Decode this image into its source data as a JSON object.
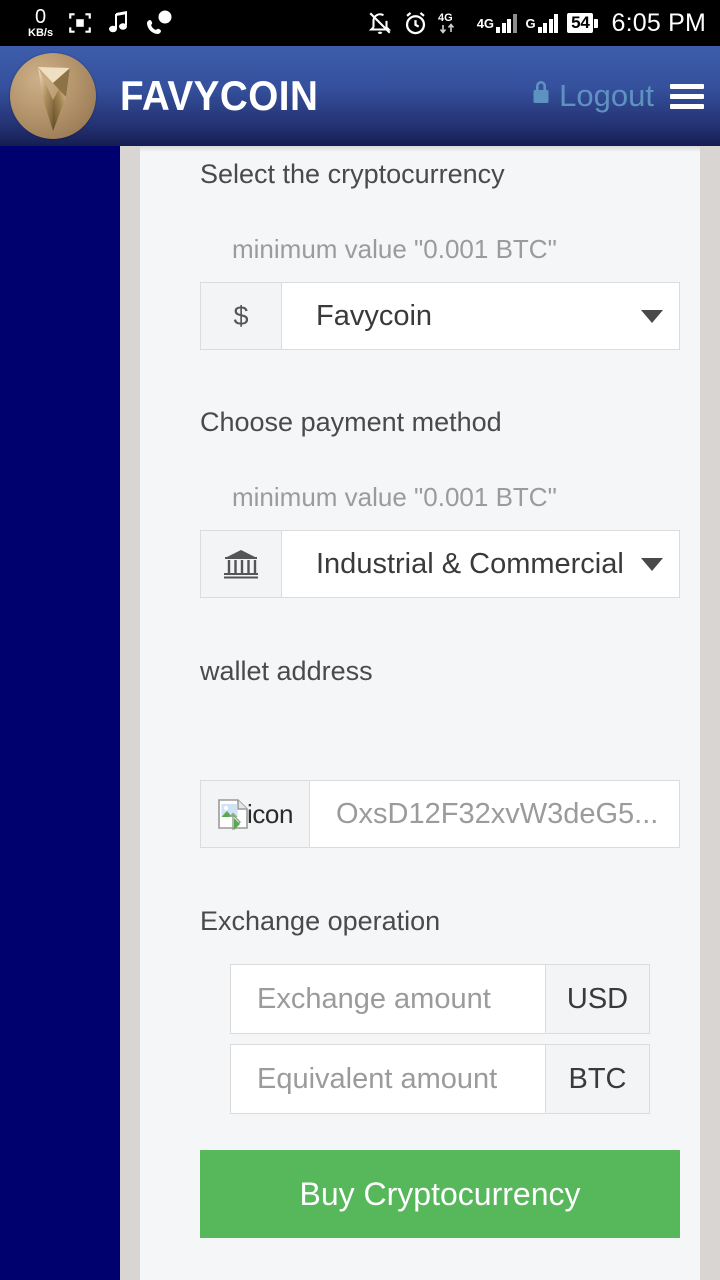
{
  "status_bar": {
    "net_speed_value": "0",
    "net_speed_unit": "KB/s",
    "icons": [
      "screenshot-icon",
      "music-note-icon",
      "call-bubble-icon",
      "mute-bell-icon",
      "alarm-clock-icon",
      "4g-data-icon",
      "signal-4g-icon",
      "signal-g-icon"
    ],
    "mobile_network_label": "4G",
    "secondary_network_label": "G",
    "battery_percent": "54",
    "clock": "6:05 PM"
  },
  "header": {
    "brand": "FAVYCOIN",
    "logo_icon": "favycoin-arrow-logo",
    "logout_label": "Logout",
    "logout_icon": "lock-icon",
    "menu_icon": "hamburger-menu-icon",
    "accent_color": "#5e92c0",
    "gradient_from": "#3d5dab",
    "gradient_to": "#151d52"
  },
  "sidebar": {
    "background_color": "#00006e"
  },
  "form": {
    "crypto": {
      "label": "Select the cryptocurrency",
      "hint": "minimum value \"0.001 BTC\"",
      "addon_symbol": "$",
      "addon_icon": "dollar-sign-icon",
      "selected": "Favycoin",
      "caret_icon": "chevron-down-icon"
    },
    "payment": {
      "label": "Choose payment method",
      "hint": "minimum value \"0.001 BTC\"",
      "addon_icon": "bank-icon",
      "selected": "Industrial & Commercial",
      "caret_icon": "chevron-down-icon"
    },
    "wallet": {
      "label": "wallet address",
      "addon_icon": "broken-image-icon",
      "addon_alt_text": "icon",
      "placeholder": "OxsD12F32xvW3deG5..."
    },
    "exchange": {
      "label": "Exchange operation",
      "amount_placeholder": "Exchange amount",
      "amount_currency": "USD",
      "equivalent_placeholder": "Equivalent amount",
      "equivalent_currency": "BTC"
    },
    "submit": {
      "label": "Buy Cryptocurrency",
      "color": "#57b75b"
    }
  }
}
